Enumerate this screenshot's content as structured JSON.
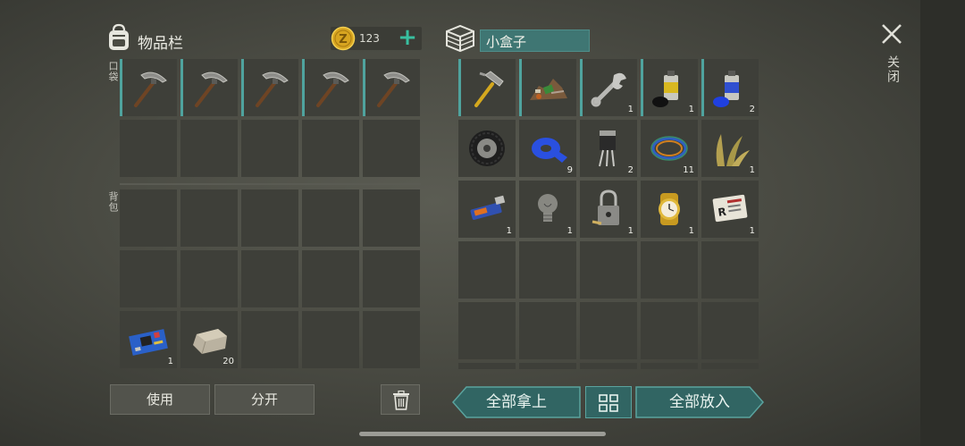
{
  "inventory": {
    "title": "物品栏",
    "coins": "123",
    "pockets_label": "口袋",
    "backpack_label": "背包",
    "pockets": [
      {
        "icon": "pickaxe-icon",
        "qty": ""
      },
      {
        "icon": "pickaxe-icon",
        "qty": ""
      },
      {
        "icon": "pickaxe-icon",
        "qty": ""
      },
      {
        "icon": "pickaxe-icon",
        "qty": ""
      },
      {
        "icon": "pickaxe-icon",
        "qty": ""
      },
      {
        "icon": "",
        "qty": ""
      },
      {
        "icon": "",
        "qty": ""
      },
      {
        "icon": "",
        "qty": ""
      },
      {
        "icon": "",
        "qty": ""
      },
      {
        "icon": "",
        "qty": ""
      }
    ],
    "backpack": [
      {
        "icon": "",
        "qty": ""
      },
      {
        "icon": "",
        "qty": ""
      },
      {
        "icon": "",
        "qty": ""
      },
      {
        "icon": "",
        "qty": ""
      },
      {
        "icon": "",
        "qty": ""
      },
      {
        "icon": "",
        "qty": ""
      },
      {
        "icon": "",
        "qty": ""
      },
      {
        "icon": "",
        "qty": ""
      },
      {
        "icon": "",
        "qty": ""
      },
      {
        "icon": "",
        "qty": ""
      },
      {
        "icon": "circuit-board-icon",
        "qty": "1"
      },
      {
        "icon": "stone-icon",
        "qty": "20"
      },
      {
        "icon": "",
        "qty": ""
      },
      {
        "icon": "",
        "qty": ""
      },
      {
        "icon": "",
        "qty": ""
      }
    ]
  },
  "container": {
    "name": "小盒子",
    "slots": [
      {
        "icon": "hammer-icon",
        "qty": ""
      },
      {
        "icon": "scrap-pile-icon",
        "qty": ""
      },
      {
        "icon": "wrench-icon",
        "qty": "1"
      },
      {
        "icon": "spray-can-black-icon",
        "qty": "1"
      },
      {
        "icon": "spray-can-blue-icon",
        "qty": "2"
      },
      {
        "icon": "tire-icon",
        "qty": ""
      },
      {
        "icon": "blue-tape-icon",
        "qty": "9"
      },
      {
        "icon": "transistor-icon",
        "qty": "2"
      },
      {
        "icon": "wire-coil-icon",
        "qty": "11"
      },
      {
        "icon": "plant-fiber-icon",
        "qty": "1"
      },
      {
        "icon": "usb-drive-icon",
        "qty": "1"
      },
      {
        "icon": "light-bulb-icon",
        "qty": "1"
      },
      {
        "icon": "padlock-icon",
        "qty": "1"
      },
      {
        "icon": "gold-watch-icon",
        "qty": "1"
      },
      {
        "icon": "id-card-icon",
        "qty": "1"
      },
      {
        "icon": "",
        "qty": ""
      },
      {
        "icon": "",
        "qty": ""
      },
      {
        "icon": "",
        "qty": ""
      },
      {
        "icon": "",
        "qty": ""
      },
      {
        "icon": "",
        "qty": ""
      },
      {
        "icon": "",
        "qty": ""
      },
      {
        "icon": "",
        "qty": ""
      },
      {
        "icon": "",
        "qty": ""
      },
      {
        "icon": "",
        "qty": ""
      },
      {
        "icon": "",
        "qty": ""
      },
      {
        "icon": "",
        "qty": ""
      },
      {
        "icon": "",
        "qty": ""
      },
      {
        "icon": "",
        "qty": ""
      },
      {
        "icon": "",
        "qty": ""
      },
      {
        "icon": "",
        "qty": ""
      }
    ]
  },
  "buttons": {
    "use": "使用",
    "split": "分开",
    "take_all": "全部拿上",
    "put_all": "全部放入",
    "close": "关闭"
  },
  "colors": {
    "accent_teal": "#3f7673",
    "plus_green": "#38c0a0",
    "background": "#4a4b43"
  }
}
